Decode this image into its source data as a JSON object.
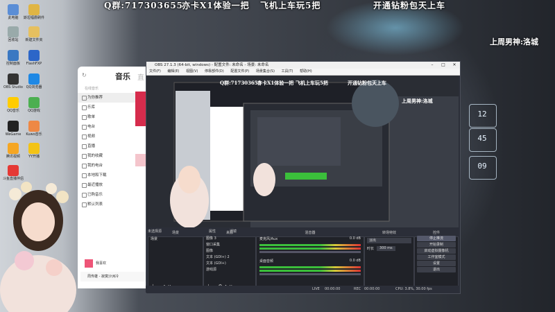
{
  "banner": {
    "left": "Q群:717303655",
    "mid1": "亦卡X1体验一把",
    "mid2": "飞机上车玩5把",
    "right": "开通钻粉包天上车"
  },
  "side_note": "上周男神:洛城",
  "clock": {
    "h1": "12",
    "m": "45",
    "s": "09"
  },
  "desktop_icons": [
    "此电脑",
    "斯坦福爵刷件",
    "回收站",
    "新建文件夹",
    "控制面板",
    "FlashFXP",
    "OBS Studio",
    "QQ浏览器",
    "QQ音乐",
    "QQ游戏",
    "WeGame",
    "Kuwo音乐",
    "腾讯视频",
    "YY开播",
    "斗鱼直播伴侣",
    "奇艺播放",
    "网易云",
    "DAE"
  ],
  "music": {
    "title": "音乐",
    "tab2": "直",
    "section": "在线音乐",
    "items": [
      "为你推荐",
      "乐库",
      "歌单",
      "电台",
      "视频",
      "直播",
      "我的收藏",
      "我的电台",
      "本地和下载",
      "最近播放",
      "已购音乐",
      "默认列表"
    ],
    "now_playing": "周传雄 - 寂寞沙洲冷",
    "user_label": "我喜欢"
  },
  "obs": {
    "title": "OBS 27.1.3 (64-bit, windows) - 配置文件: 未命名 - 场景: 未命名",
    "menu": [
      "文件(F)",
      "编辑(E)",
      "视图(V)",
      "停靠部件(D)",
      "配置文件(P)",
      "场景集合(S)",
      "工具(T)",
      "帮助(H)"
    ],
    "no_source": "未选择源",
    "attrs": "属性",
    "filters": "滤镜",
    "docks": {
      "scenes": {
        "title": "场景",
        "items": [
          "场景"
        ]
      },
      "sources": {
        "title": "来源",
        "items": [
          "图像 3",
          "窗口采集",
          "图像",
          "文本 (GDI+) 2",
          "文本 (GDI+)",
          "游戏源"
        ]
      },
      "mixer": {
        "title": "混音器",
        "tracks": [
          {
            "name": "麦克风/Aux",
            "level": "0.0 dB"
          },
          {
            "name": "桌面音频",
            "level": "0.0 dB"
          }
        ]
      },
      "transitions": {
        "title": "转场特效",
        "type": "淡出",
        "duration_label": "时长",
        "duration": "300 ms"
      },
      "controls": {
        "title": "控件",
        "buttons": [
          "停止推流",
          "开始录制",
          "启动虚拟摄像机",
          "工作室模式",
          "设置",
          "退出"
        ]
      }
    },
    "status": {
      "dropped": "丢帧 0 (0.0%)",
      "live_label": "LIVE",
      "live": "00:00:00",
      "rec_label": "REC",
      "rec": "00:00:00",
      "cpu": "CPU: 3.8%, 30.00 fps",
      "kbps": "kb/s"
    }
  }
}
